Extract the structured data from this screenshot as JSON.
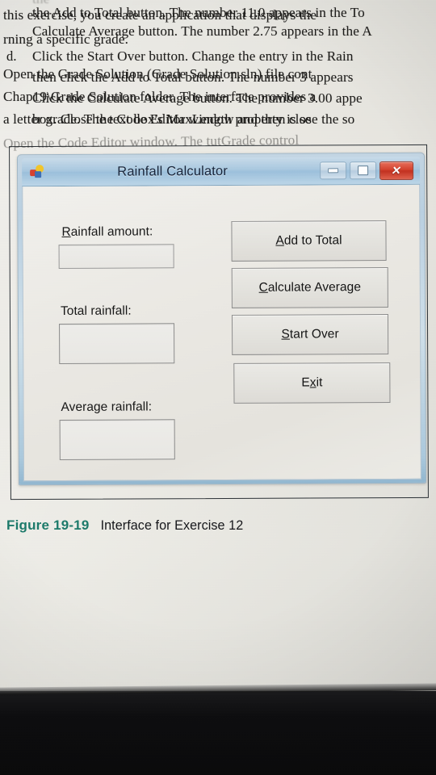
{
  "page": {
    "top_paragraph_lines": [
      "the Add to Total button. The number 11.0 appears in the To",
      "Calculate Average button. The number 2.75 appears in the A"
    ],
    "list_item": {
      "marker": "d.",
      "lines": [
        "Click the Start Over button. Change the entry in the Rain",
        "then click the Add to Total button. The number 3 appears",
        "Click the Calculate Average button. The number 3.00 appe",
        "box. Close the Code Editor window and then close the so"
      ]
    },
    "bottom_paragraph_lines": [
      "this exercise, you create an application that displays the",
      "rning a specific grade."
    ],
    "bottom_numbered_lines": [
      "Open the Grade Solution (Grade Solution.sln) file cont",
      "Chap19\\Grade Solution folder. The interface provides a",
      "a letter grade. The text box's MaxLength property is se",
      "Open the Code Editor window. The tutGrade control"
    ]
  },
  "caption": {
    "figure_number": "Figure 19-19",
    "text": "Interface for Exercise 12",
    "accent_color": "#1c7a6a"
  },
  "window": {
    "title": "Rainfall Calculator",
    "icon": "application-form-icon",
    "controls": {
      "minimize": "–",
      "maximize": "□",
      "close": "✕"
    },
    "labels": [
      {
        "id": "rainfall-amount",
        "pre": "",
        "accesskey": "R",
        "post": "ainfall amount:"
      },
      {
        "id": "total-rainfall",
        "pre": "Total rainfall:",
        "accesskey": "",
        "post": ""
      },
      {
        "id": "average-rainfall",
        "pre": "Average rainfall:",
        "accesskey": "",
        "post": ""
      }
    ],
    "textboxes": [
      {
        "id": "rainfall-amount-textbox",
        "value": ""
      },
      {
        "id": "total-rainfall-box",
        "value": ""
      },
      {
        "id": "average-rainfall-box",
        "value": ""
      }
    ],
    "buttons": [
      {
        "id": "add-to-total",
        "pre": "",
        "accesskey": "A",
        "post": "dd to Total"
      },
      {
        "id": "calculate-average",
        "pre": "",
        "accesskey": "C",
        "post": "alculate Average"
      },
      {
        "id": "start-over",
        "pre": "",
        "accesskey": "S",
        "post": "tart Over"
      },
      {
        "id": "exit",
        "pre": "E",
        "accesskey": "x",
        "post": "it"
      }
    ]
  }
}
